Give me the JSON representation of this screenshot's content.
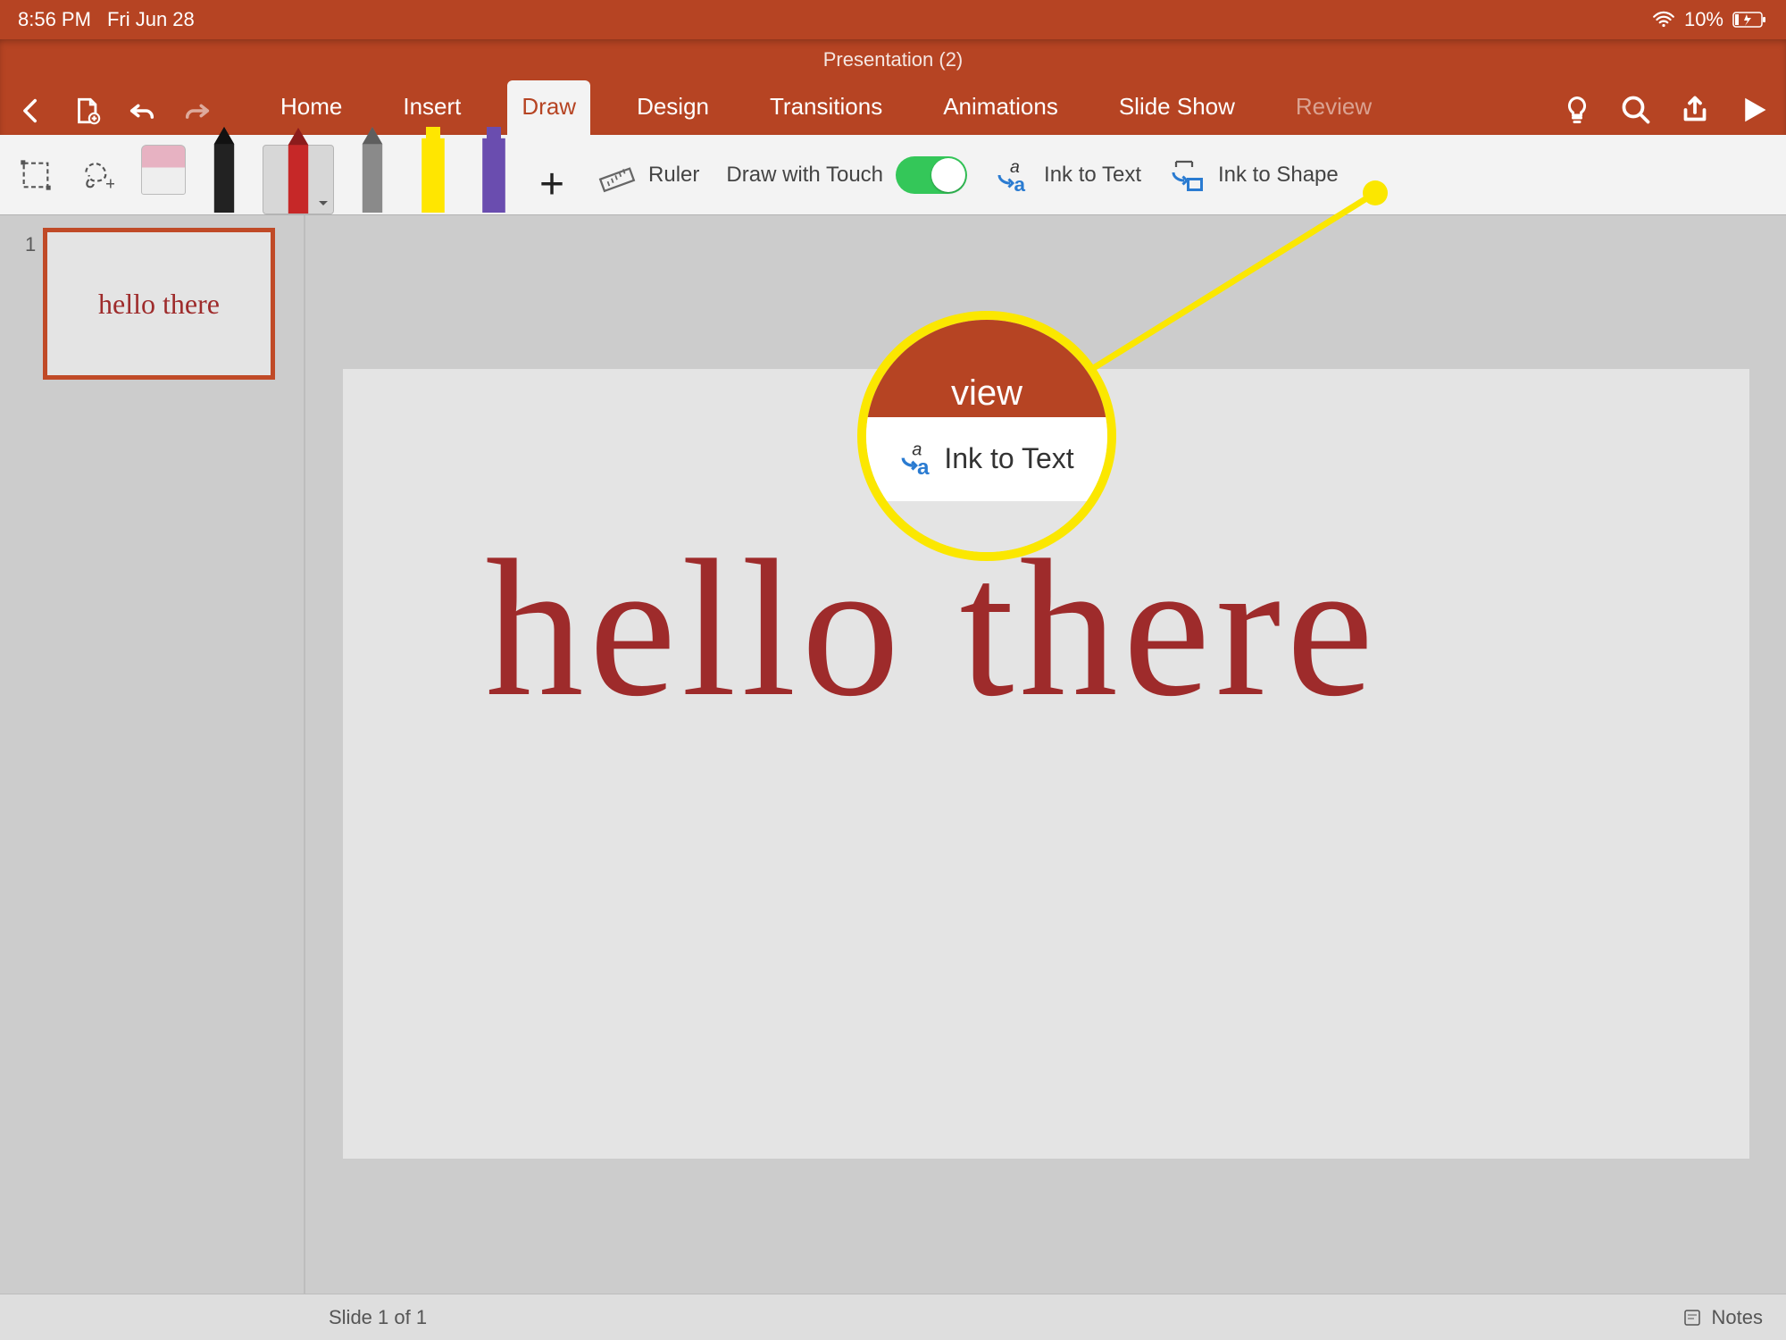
{
  "status_bar": {
    "time": "8:56 PM",
    "date": "Fri Jun 28",
    "battery_pct": "10%"
  },
  "header": {
    "document_title": "Presentation (2)",
    "tabs": [
      {
        "label": "Home"
      },
      {
        "label": "Insert"
      },
      {
        "label": "Draw",
        "active": true
      },
      {
        "label": "Design"
      },
      {
        "label": "Transitions"
      },
      {
        "label": "Animations"
      },
      {
        "label": "Slide Show"
      },
      {
        "label": "Review",
        "disabled": true
      }
    ]
  },
  "draw_toolbar": {
    "pens": [
      {
        "name": "eraser",
        "color": "#e7b2c2"
      },
      {
        "name": "pen-black",
        "color": "#222222"
      },
      {
        "name": "pen-red",
        "color": "#c62828",
        "selected": true
      },
      {
        "name": "pencil-gray",
        "color": "#8a8a8a"
      },
      {
        "name": "highlighter-yellow",
        "color": "#ffe600"
      },
      {
        "name": "highlighter-purple",
        "color": "#6a4daf"
      }
    ],
    "ruler_label": "Ruler",
    "draw_with_touch_label": "Draw with Touch",
    "draw_with_touch_on": true,
    "ink_to_text_label": "Ink to Text",
    "ink_to_shape_label": "Ink to Shape"
  },
  "thumbnails": [
    {
      "index": "1",
      "handwriting": "hello there"
    }
  ],
  "slide": {
    "handwriting": "hello there"
  },
  "status_footer": {
    "slide_counter": "Slide 1 of 1",
    "notes_label": "Notes"
  },
  "callout": {
    "tab_peek": "view",
    "label": "Ink to Text"
  }
}
